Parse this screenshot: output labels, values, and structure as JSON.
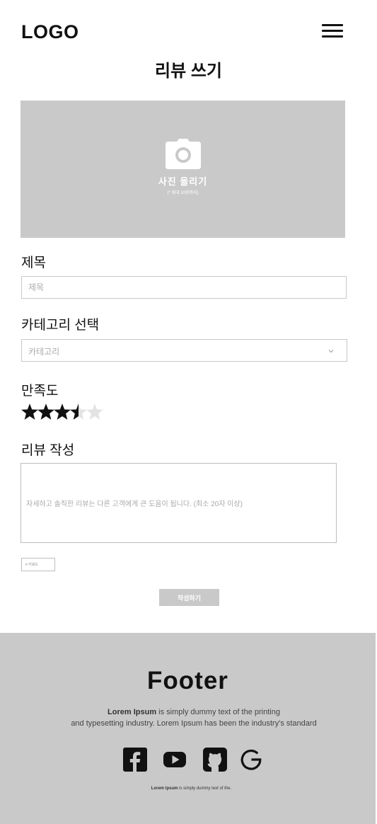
{
  "header": {
    "logo": "LOGO",
    "menu_icon": "hamburger-menu-icon"
  },
  "page": {
    "title": "리뷰 쓰기"
  },
  "photo_upload": {
    "icon": "camera-icon",
    "label": "사진 올리기",
    "note": "(* 최대 10장까지)"
  },
  "form": {
    "title_label": "제목",
    "title_placeholder": "제목",
    "category_label": "카테고리 선택",
    "category_value": "카테고리",
    "satisfaction_label": "만족도",
    "rating": 3.5,
    "rating_max": 5,
    "review_label": "리뷰 작성",
    "review_placeholder": "자세하고 솔직한 리뷰는 다른 고객에게 큰 도움이 됩니다. (최소 20자 이상)",
    "keyword_placeholder": "# 키워드",
    "submit_label": "작성하기"
  },
  "footer": {
    "title": "Footer",
    "text_bold": "Lorem Ipsum",
    "text_line1": " is simply dummy text of the printing",
    "text_line2": "and typesetting industry. Lorem Ipsum has been the industry's standard",
    "social_icons": [
      "facebook-icon",
      "youtube-icon",
      "github-icon",
      "google-icon"
    ],
    "small_bold": "Lorem Ipsum",
    "small_text": " is simply dummy text of the."
  },
  "colors": {
    "placeholder_gray": "#c9c9c9",
    "star_filled": "#111111",
    "star_empty": "#e3e3e3",
    "text": "#111111"
  }
}
